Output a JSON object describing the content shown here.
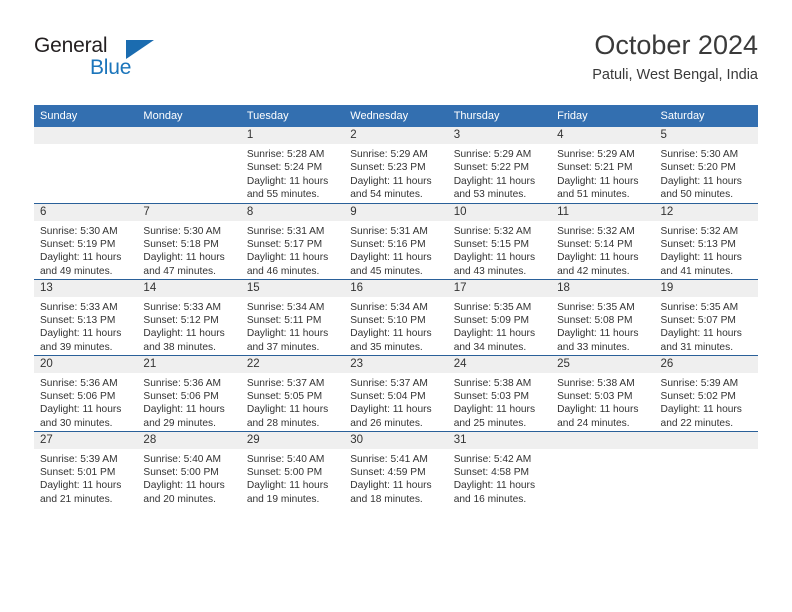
{
  "brand": {
    "line1": "General",
    "line2": "Blue",
    "triangle_color": "#1b6cb0"
  },
  "header": {
    "title": "October 2024",
    "subtitle": "Patuli, West Bengal, India"
  },
  "colors": {
    "header_band": "#336fb0",
    "row_divider": "#2a6099",
    "daynum_band": "#efefef",
    "text": "#333333"
  },
  "labels": {
    "sunrise_prefix": "Sunrise:",
    "sunset_prefix": "Sunset:",
    "daylight_prefix": "Daylight:"
  },
  "weekdays": [
    "Sunday",
    "Monday",
    "Tuesday",
    "Wednesday",
    "Thursday",
    "Friday",
    "Saturday"
  ],
  "weeks": [
    [
      {
        "day": "",
        "empty": true
      },
      {
        "day": "",
        "empty": true
      },
      {
        "day": "1",
        "sunrise": "Sunrise: 5:28 AM",
        "sunset": "Sunset: 5:24 PM",
        "daylight_l1": "Daylight: 11 hours",
        "daylight_l2": "and 55 minutes."
      },
      {
        "day": "2",
        "sunrise": "Sunrise: 5:29 AM",
        "sunset": "Sunset: 5:23 PM",
        "daylight_l1": "Daylight: 11 hours",
        "daylight_l2": "and 54 minutes."
      },
      {
        "day": "3",
        "sunrise": "Sunrise: 5:29 AM",
        "sunset": "Sunset: 5:22 PM",
        "daylight_l1": "Daylight: 11 hours",
        "daylight_l2": "and 53 minutes."
      },
      {
        "day": "4",
        "sunrise": "Sunrise: 5:29 AM",
        "sunset": "Sunset: 5:21 PM",
        "daylight_l1": "Daylight: 11 hours",
        "daylight_l2": "and 51 minutes."
      },
      {
        "day": "5",
        "sunrise": "Sunrise: 5:30 AM",
        "sunset": "Sunset: 5:20 PM",
        "daylight_l1": "Daylight: 11 hours",
        "daylight_l2": "and 50 minutes."
      }
    ],
    [
      {
        "day": "6",
        "sunrise": "Sunrise: 5:30 AM",
        "sunset": "Sunset: 5:19 PM",
        "daylight_l1": "Daylight: 11 hours",
        "daylight_l2": "and 49 minutes."
      },
      {
        "day": "7",
        "sunrise": "Sunrise: 5:30 AM",
        "sunset": "Sunset: 5:18 PM",
        "daylight_l1": "Daylight: 11 hours",
        "daylight_l2": "and 47 minutes."
      },
      {
        "day": "8",
        "sunrise": "Sunrise: 5:31 AM",
        "sunset": "Sunset: 5:17 PM",
        "daylight_l1": "Daylight: 11 hours",
        "daylight_l2": "and 46 minutes."
      },
      {
        "day": "9",
        "sunrise": "Sunrise: 5:31 AM",
        "sunset": "Sunset: 5:16 PM",
        "daylight_l1": "Daylight: 11 hours",
        "daylight_l2": "and 45 minutes."
      },
      {
        "day": "10",
        "sunrise": "Sunrise: 5:32 AM",
        "sunset": "Sunset: 5:15 PM",
        "daylight_l1": "Daylight: 11 hours",
        "daylight_l2": "and 43 minutes."
      },
      {
        "day": "11",
        "sunrise": "Sunrise: 5:32 AM",
        "sunset": "Sunset: 5:14 PM",
        "daylight_l1": "Daylight: 11 hours",
        "daylight_l2": "and 42 minutes."
      },
      {
        "day": "12",
        "sunrise": "Sunrise: 5:32 AM",
        "sunset": "Sunset: 5:13 PM",
        "daylight_l1": "Daylight: 11 hours",
        "daylight_l2": "and 41 minutes."
      }
    ],
    [
      {
        "day": "13",
        "sunrise": "Sunrise: 5:33 AM",
        "sunset": "Sunset: 5:13 PM",
        "daylight_l1": "Daylight: 11 hours",
        "daylight_l2": "and 39 minutes."
      },
      {
        "day": "14",
        "sunrise": "Sunrise: 5:33 AM",
        "sunset": "Sunset: 5:12 PM",
        "daylight_l1": "Daylight: 11 hours",
        "daylight_l2": "and 38 minutes."
      },
      {
        "day": "15",
        "sunrise": "Sunrise: 5:34 AM",
        "sunset": "Sunset: 5:11 PM",
        "daylight_l1": "Daylight: 11 hours",
        "daylight_l2": "and 37 minutes."
      },
      {
        "day": "16",
        "sunrise": "Sunrise: 5:34 AM",
        "sunset": "Sunset: 5:10 PM",
        "daylight_l1": "Daylight: 11 hours",
        "daylight_l2": "and 35 minutes."
      },
      {
        "day": "17",
        "sunrise": "Sunrise: 5:35 AM",
        "sunset": "Sunset: 5:09 PM",
        "daylight_l1": "Daylight: 11 hours",
        "daylight_l2": "and 34 minutes."
      },
      {
        "day": "18",
        "sunrise": "Sunrise: 5:35 AM",
        "sunset": "Sunset: 5:08 PM",
        "daylight_l1": "Daylight: 11 hours",
        "daylight_l2": "and 33 minutes."
      },
      {
        "day": "19",
        "sunrise": "Sunrise: 5:35 AM",
        "sunset": "Sunset: 5:07 PM",
        "daylight_l1": "Daylight: 11 hours",
        "daylight_l2": "and 31 minutes."
      }
    ],
    [
      {
        "day": "20",
        "sunrise": "Sunrise: 5:36 AM",
        "sunset": "Sunset: 5:06 PM",
        "daylight_l1": "Daylight: 11 hours",
        "daylight_l2": "and 30 minutes."
      },
      {
        "day": "21",
        "sunrise": "Sunrise: 5:36 AM",
        "sunset": "Sunset: 5:06 PM",
        "daylight_l1": "Daylight: 11 hours",
        "daylight_l2": "and 29 minutes."
      },
      {
        "day": "22",
        "sunrise": "Sunrise: 5:37 AM",
        "sunset": "Sunset: 5:05 PM",
        "daylight_l1": "Daylight: 11 hours",
        "daylight_l2": "and 28 minutes."
      },
      {
        "day": "23",
        "sunrise": "Sunrise: 5:37 AM",
        "sunset": "Sunset: 5:04 PM",
        "daylight_l1": "Daylight: 11 hours",
        "daylight_l2": "and 26 minutes."
      },
      {
        "day": "24",
        "sunrise": "Sunrise: 5:38 AM",
        "sunset": "Sunset: 5:03 PM",
        "daylight_l1": "Daylight: 11 hours",
        "daylight_l2": "and 25 minutes."
      },
      {
        "day": "25",
        "sunrise": "Sunrise: 5:38 AM",
        "sunset": "Sunset: 5:03 PM",
        "daylight_l1": "Daylight: 11 hours",
        "daylight_l2": "and 24 minutes."
      },
      {
        "day": "26",
        "sunrise": "Sunrise: 5:39 AM",
        "sunset": "Sunset: 5:02 PM",
        "daylight_l1": "Daylight: 11 hours",
        "daylight_l2": "and 22 minutes."
      }
    ],
    [
      {
        "day": "27",
        "sunrise": "Sunrise: 5:39 AM",
        "sunset": "Sunset: 5:01 PM",
        "daylight_l1": "Daylight: 11 hours",
        "daylight_l2": "and 21 minutes."
      },
      {
        "day": "28",
        "sunrise": "Sunrise: 5:40 AM",
        "sunset": "Sunset: 5:00 PM",
        "daylight_l1": "Daylight: 11 hours",
        "daylight_l2": "and 20 minutes."
      },
      {
        "day": "29",
        "sunrise": "Sunrise: 5:40 AM",
        "sunset": "Sunset: 5:00 PM",
        "daylight_l1": "Daylight: 11 hours",
        "daylight_l2": "and 19 minutes."
      },
      {
        "day": "30",
        "sunrise": "Sunrise: 5:41 AM",
        "sunset": "Sunset: 4:59 PM",
        "daylight_l1": "Daylight: 11 hours",
        "daylight_l2": "and 18 minutes."
      },
      {
        "day": "31",
        "sunrise": "Sunrise: 5:42 AM",
        "sunset": "Sunset: 4:58 PM",
        "daylight_l1": "Daylight: 11 hours",
        "daylight_l2": "and 16 minutes."
      },
      {
        "day": "",
        "empty": true
      },
      {
        "day": "",
        "empty": true
      }
    ]
  ]
}
